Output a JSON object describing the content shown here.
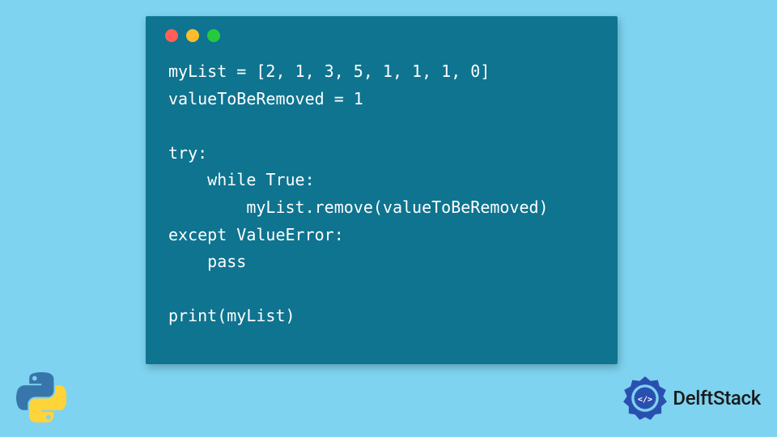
{
  "code": {
    "lines": [
      "myList = [2, 1, 3, 5, 1, 1, 1, 0]",
      "valueToBeRemoved = 1",
      "",
      "try:",
      "    while True:",
      "        myList.remove(valueToBeRemoved)",
      "except ValueError:",
      "    pass",
      "",
      "print(myList)"
    ]
  },
  "brand": {
    "name": "DelftStack"
  },
  "colors": {
    "background": "#7dd3f0",
    "window": "#0e7490",
    "dotRed": "#ff5f56",
    "dotYellow": "#ffbd2e",
    "dotGreen": "#27c93f",
    "brandBlue": "#2b4fb0"
  }
}
